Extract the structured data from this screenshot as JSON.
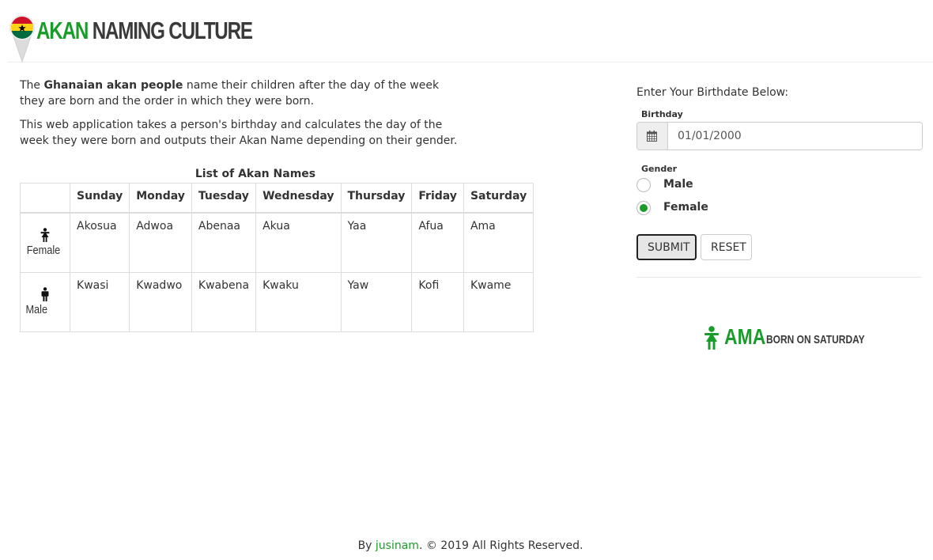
{
  "header": {
    "brand_akan": "AKAN",
    "brand_rest": " NAMING CULTURE",
    "flag_colors": [
      "#ce1126",
      "#fcd116",
      "#006b3f"
    ]
  },
  "intro": {
    "p1_pre": "The ",
    "p1_bold": "Ghanaian akan people",
    "p1_post": " name their children after the day of the week they are born and the order in which they were born.",
    "p2": "This web application takes a person's birthday and calculates the day of the week they were born and outputs their Akan Name depending on their gender."
  },
  "table": {
    "caption": "List of Akan Names",
    "days": [
      "Sunday",
      "Monday",
      "Tuesday",
      "Wednesday",
      "Thursday",
      "Friday",
      "Saturday"
    ],
    "rows": [
      {
        "label": "Female",
        "icon": "female-icon",
        "names": [
          "Akosua",
          "Adwoa",
          "Abenaa",
          "Akua",
          "Yaa",
          "Afua",
          "Ama"
        ]
      },
      {
        "label": "Male",
        "icon": "male-icon",
        "names": [
          "Kwasi",
          "Kwadwo",
          "Kwabena",
          "Kwaku",
          "Yaw",
          "Kofi",
          "Kwame"
        ]
      }
    ]
  },
  "form": {
    "prompt": "Enter Your Birthdate Below:",
    "birthday_label": "Birthday",
    "birthday_value": "01/01/2000",
    "gender_label": "Gender",
    "male_label": "Male",
    "female_label": "Female",
    "selected_gender": "Female",
    "submit_label": "SUBMIT",
    "reset_label": "RESET"
  },
  "result": {
    "name": "AMA",
    "born_on": "BORN ON  SATURDAY",
    "icon": "female-icon"
  },
  "footer": {
    "prefix": "By ",
    "author": "jusinam",
    "suffix": ". © 2019 All Rights Reserved."
  },
  "colors": {
    "accent": "#1a9c2a",
    "text": "#333333",
    "brand_dark": "#3a3a3a"
  }
}
